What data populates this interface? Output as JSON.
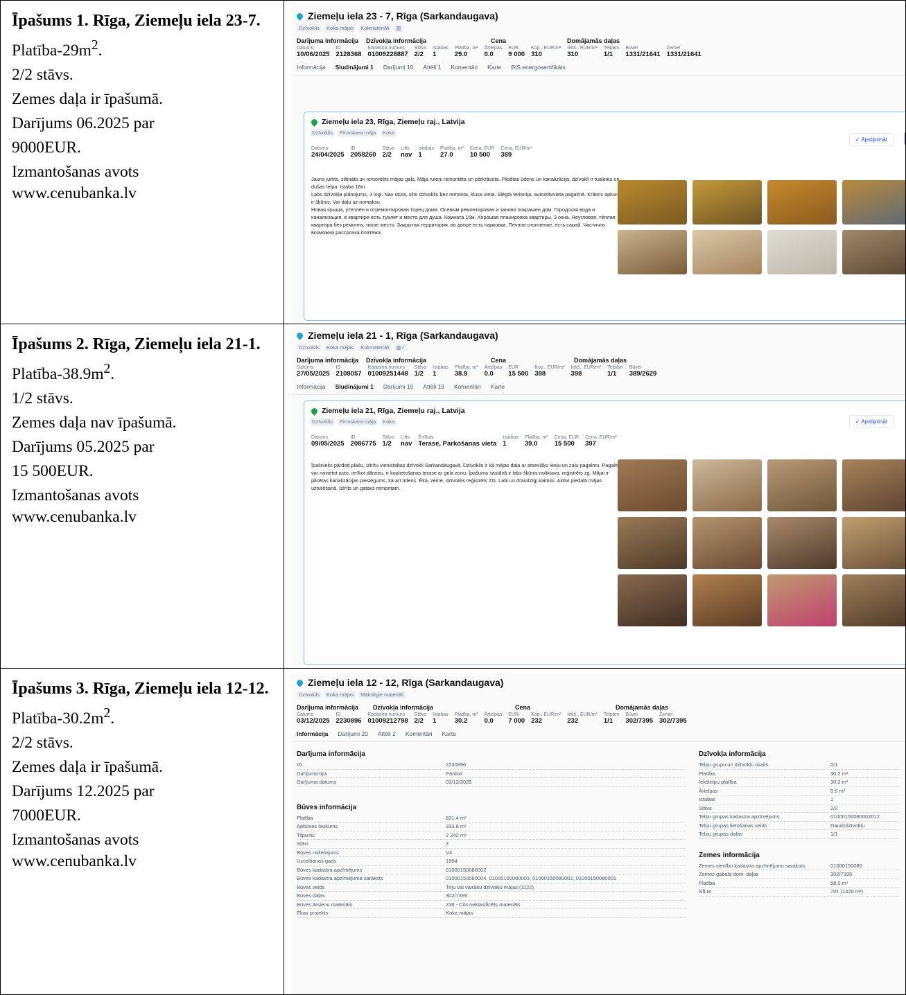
{
  "rows": [
    {
      "left": {
        "title": "Īpašums 1. Rīga, Ziemeļu iela 23-7.",
        "area": "Platība-29m",
        "floor": "2/2 stāvs.",
        "land": "Zemes daļa ir īpašumā.",
        "deal": "Darījums 06.2025 par",
        "price": "9000EUR.",
        "source_label": "Izmantošanas avots",
        "source_url": "www.cenubanka.lv"
      },
      "shot": {
        "address": "Ziemeļu iela 23 - 7, Rīga (Sarkandaugava)",
        "tags": [
          "Dzīvoklis",
          "Koka mājas",
          "Kokmateriāli"
        ],
        "sections": [
          "Darījuma informācija",
          "Dzīvokļa informācija",
          "Cena",
          "Domājamās daļas"
        ],
        "kv": [
          [
            "Datums",
            "10/06/2025"
          ],
          [
            "ID",
            "2128368"
          ],
          [
            "Kadastra numurs",
            "01009228887"
          ],
          [
            "Stāvs",
            "2/2"
          ],
          [
            "Istabas",
            "1"
          ],
          [
            "Platība, m²",
            "29.0"
          ],
          [
            "Ārtelpas",
            "0.0"
          ],
          [
            "EUR",
            "9 000"
          ],
          [
            "Kop., EUR/m²",
            "310"
          ],
          [
            "Iekš., EUR/m²",
            "310"
          ],
          [
            "Telpām",
            "1/1"
          ],
          [
            "Būvei",
            "1331/21641"
          ],
          [
            "Zemei",
            "1331/21641"
          ]
        ],
        "tabs": [
          "Informācija",
          "Sludinājumi 1",
          "Darījumi 10",
          "Attēli 1",
          "Komentāri",
          "Karte",
          "BIS energosertifikāts"
        ],
        "card": {
          "address": "Ziemeļu iela 23, Rīga, Ziemeļu raj., Latvija",
          "tags": [
            "Dzīvoklis",
            "Pirmskara māja",
            "Koka"
          ],
          "kv": [
            [
              "Datums",
              "24/04/2025"
            ],
            [
              "ID",
              "2058260"
            ],
            [
              "Stāvs",
              "2/2"
            ],
            [
              "Lifts",
              "nav"
            ],
            [
              "Istabas",
              "1"
            ],
            [
              "Platība, m²",
              "27.0"
            ],
            [
              "Cena, EUR",
              "10 500"
            ],
            [
              "Cena, EUR/m²",
              "389"
            ]
          ],
          "confirm": "✓ Apstiprināt",
          "desc": [
            "Jauns jumts, siltināts un remontēts mājas gals. Māja ruteņi remontēta un pārkrāsota. Pilsētas ūdens un kanalizācija, dzīvoklī ir tualetes un dušas telpa. Istaba 16m.",
            "Labs dzīvokļa plānojums, 3 logi. Nav stūra, silts dzīvoklis bez remonta, klusa vieta. Slēgta teritorija, autostāvvieta pagalmā. Krāsns apkure, ir šķūnis. Var daļu uz nomaksu.",
            "Новая крыша, утеплён и отремонтирован торец дома. Осевым ремонтирован и заново покрашен дом. Городская вода и канализация, в квартире есть туалет и место для душа. Комната 16м. Хорошая планировка квартиры, 3 окна. Неугловая, тёплая квартира без ремонта, тихое место. Закрытая территория, во дворе есть парковка. Печное отопление, есть сарай. Частично возможна рассрочка платежа."
          ]
        }
      }
    },
    {
      "left": {
        "title": "Īpašums 2. Rīga, Ziemeļu iela 21-1.",
        "area": "Platība-38.9m",
        "floor": "1/2 stāvs.",
        "land": "Zemes daļa nav īpašumā.",
        "deal": "Darījums 05.2025 par",
        "price": "15 500EUR.",
        "source_label": "Izmantošanas avots",
        "source_url": "www.cenubanka.lv"
      },
      "shot": {
        "address": "Ziemeļu iela 21 - 1, Rīga (Sarkandaugava)",
        "tags": [
          "Dzīvoklis",
          "Koka mājas",
          "Kokmateriāli"
        ],
        "sections": [
          "Darījuma informācija",
          "Dzīvokļa informācija",
          "Cena",
          "Domājamās daļas"
        ],
        "kv": [
          [
            "Datums",
            "27/05/2025"
          ],
          [
            "ID",
            "2108057"
          ],
          [
            "Kadastra numurs",
            "01009251448"
          ],
          [
            "Stāvs",
            "1/2"
          ],
          [
            "Istabas",
            "1"
          ],
          [
            "Platība, m²",
            "38.9"
          ],
          [
            "Ārtelpas",
            "0.0"
          ],
          [
            "EUR",
            "15 500"
          ],
          [
            "Kop., EUR/m²",
            "398"
          ],
          [
            "Iekš., EUR/m²",
            "398"
          ],
          [
            "Telpām",
            "1/1"
          ],
          [
            "Būvei",
            "389/2629"
          ]
        ],
        "tabs": [
          "Informācija",
          "Sludinājumi 1",
          "Darījumi 10",
          "Attēli 19",
          "Komentāri",
          "Karte"
        ],
        "card": {
          "address": "Ziemeļu iela 21, Rīga, Ziemeļu raj., Latvija",
          "tags": [
            "Dzīvoklis",
            "Pirmskara māja",
            "Koka"
          ],
          "kv": [
            [
              "Datums",
              "09/05/2025"
            ],
            [
              "ID",
              "2086775"
            ],
            [
              "Stāvs",
              "1/2"
            ],
            [
              "Lifts",
              "nav"
            ],
            [
              "Ērtības",
              "Terase, Parkošanas vieta"
            ],
            [
              "Istabas",
              "1"
            ],
            [
              "Platība, m²",
              "39.0"
            ],
            [
              "Cena, EUR",
              "15 500"
            ],
            [
              "Cena, EUR/m²",
              "397"
            ]
          ],
          "confirm": "✓ Apstiprināt",
          "desc": [
            "Īpašnieks pārdod plašu, izīrītu vienistabas dzīvokli Sarkandaugavā. Dzīvoklis ir kā mājas daļa ar atsevišķu ieeju un zaļu pagalmu. Pagalmā var novietot auto, ierīkot dārziņu, ir koplietošanas terase ar grila zonu. Īpašuma sastāvā ir labs šķūnis-noliktava, reģistrēts zg. Mājai ir pilsētas kanalizācijas pieslēgums, kā arī ūdens. Ēka, zeme, dzīvoklis reģistrēts ZG. Labi un draudzīgi kaimiņi. Aktīvi piedalā mājas uzturēšanā. Izīrīts un gatavs remontam."
          ]
        }
      }
    },
    {
      "left": {
        "title": "Īpašums 3. Rīga, Ziemeļu iela 12-12.",
        "area": "Platība-30.2m",
        "floor": "2/2 stāvs.",
        "land": "Zemes daļa ir īpašumā.",
        "deal": "Darījums 12.2025 par",
        "price": "7000EUR.",
        "source_label": "Izmantošanas avots",
        "source_url": "www.cenubanka.lv"
      },
      "shot": {
        "address": "Ziemeļu iela 12 - 12, Rīga (Sarkandaugava)",
        "tags": [
          "Dzīvoklis",
          "Koka mājas",
          "Mākslīgie materiāli"
        ],
        "sections": [
          "Darījuma informācija",
          "Dzīvokļa informācija",
          "Cena",
          "Domājamās daļas"
        ],
        "kv": [
          [
            "Datums",
            "03/12/2025"
          ],
          [
            "ID",
            "2230896"
          ],
          [
            "Kadastra numurs",
            "01009212798"
          ],
          [
            "Stāvs",
            "2/2"
          ],
          [
            "Istabas",
            "1"
          ],
          [
            "Platība, m²",
            "30.2"
          ],
          [
            "Ārtelpas",
            "0.0"
          ],
          [
            "EUR",
            "7 000"
          ],
          [
            "Kop., EUR/m²",
            "232"
          ],
          [
            "Iekš., EUR/m²",
            "232"
          ],
          [
            "Telpām",
            "1/1"
          ],
          [
            "Būvei",
            "302/7395"
          ],
          [
            "Zemei",
            "302/7395"
          ]
        ],
        "tabs": [
          "Informācija",
          "Darījumi 20",
          "Attēli 2",
          "Komentāri",
          "Karte"
        ],
        "details": {
          "deal_title": "Darījuma informācija",
          "deal": [
            [
              "ID",
              "2230896"
            ],
            [
              "Darījuma tips",
              "Pārdod"
            ],
            [
              "Darījuma datums",
              "03/12/2025"
            ]
          ],
          "building_title": "Būves informācija",
          "building": [
            [
              "Platība",
              "631.4 m²"
            ],
            [
              "Apbūves laukums",
              "333.8 m²"
            ],
            [
              "Tilpums",
              "2 242 m³"
            ],
            [
              "Stāvi",
              "2"
            ],
            [
              "Būves nolietojums",
              "V4"
            ],
            [
              "Uzcelšanas gads",
              "1904"
            ],
            [
              "Būves kadastra apzīmējums",
              "01000150080002"
            ],
            [
              "Būves kadastra apzīmējuma saraksts",
              "01000150080004, 01000150080003, 01000150080002, 01000150080001"
            ],
            [
              "Būves veids",
              "Triju vai vairāku dzīvokļu mājas (1122)"
            ],
            [
              "Būves daļas",
              "302/7395"
            ],
            [
              "Būves ārsienu materiāls",
              "238 - Cits neklasificēts materiāls"
            ],
            [
              "Ēkas projekts",
              "Koka mājas"
            ]
          ],
          "flat_title": "Dzīvokļa informācija",
          "flat": [
            [
              "Telpu grupu un dzīvokļu skaits",
              "0/1"
            ],
            [
              "Platība",
              "30.2 m²"
            ],
            [
              "Iekštelpu platība",
              "30.2 m²"
            ],
            [
              "Ārtelpas",
              "0.0 m²"
            ],
            [
              "Istabas",
              "1"
            ],
            [
              "Stāvs",
              "2/2"
            ],
            [
              "Telpu grupas kadastra apzīmējums",
              "01000150080002012"
            ],
            [
              "Telpu grupas lietošanas veids",
              "Daudzdzīvokļu"
            ],
            [
              "Telpu grupas daļas",
              "1/1"
            ]
          ],
          "land_title": "Zemes informācija",
          "land": [
            [
              "Zemes vienību kadastra apzīmējumu saraksts",
              "01000150080"
            ],
            [
              "Zemes gabala dom. daļas",
              "302/7395"
            ],
            [
              "Platība",
              "58.0 m²"
            ],
            [
              "NĪLM",
              "701 (1420 m²)"
            ]
          ]
        }
      }
    }
  ]
}
